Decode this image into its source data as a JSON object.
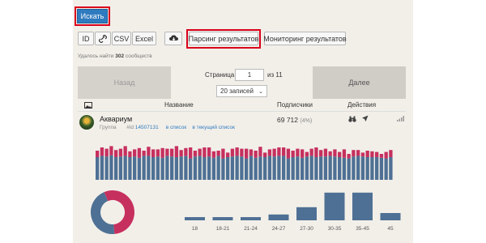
{
  "search_button": "Искать",
  "export_buttons": [
    "ID",
    "CSV",
    "Excel"
  ],
  "parse_button": "Парсинг результатов",
  "monitor_button": "Мониторинг результатов",
  "found_prefix": "Удалось найти",
  "found_count": "302",
  "found_suffix": "сообществ",
  "pager": {
    "back": "Назад",
    "page_label": "Страница",
    "page_value": "1",
    "of_label": "из 11",
    "per_page": "20 записей",
    "next": "Далее"
  },
  "table": {
    "col_name": "Название",
    "col_subs": "Подписчики",
    "col_actions": "Действия"
  },
  "row": {
    "name": "Аквариум",
    "type": "Группа",
    "id_label": "#id",
    "id_value": "14507131",
    "to_list": "в список",
    "to_current_list": "в текущий список",
    "subscribers": "69 712",
    "percent": "(4%)"
  },
  "colors": {
    "accent_blue": "#2f7bbf",
    "bar_blue": "#4e7094",
    "bar_red": "#c6305f",
    "highlight_red": "#d9001b"
  },
  "chart_data": [
    {
      "type": "bar",
      "stacked": true,
      "series": [
        {
          "values": [
            0.7,
            0.74,
            0.72,
            0.76,
            0.7,
            0.72,
            0.74,
            0.7,
            0.72,
            0.68,
            0.74,
            0.74,
            0.7,
            0.72,
            0.68,
            0.74,
            0.72,
            0.7,
            0.72,
            0.74,
            0.66,
            0.72,
            0.74,
            0.7,
            0.72,
            0.68,
            0.74,
            0.66,
            0.7,
            0.72,
            0.74,
            0.72,
            0.66,
            0.74,
            0.68,
            0.72,
            0.7,
            0.74,
            0.72,
            0.74,
            0.74,
            0.66,
            0.7,
            0.72,
            0.68,
            0.72,
            0.74,
            0.7,
            0.72,
            0.72,
            0.74,
            0.72,
            0.7,
            0.68,
            0.66,
            0.72,
            0.74,
            0.72,
            0.7,
            0.7,
            0.7,
            0.68,
            0.66,
            0.7
          ]
        },
        {
          "values": [
            0.2,
            0.26,
            0.24,
            0.28,
            0.22,
            0.24,
            0.3,
            0.18,
            0.22,
            0.3,
            0.16,
            0.28,
            0.24,
            0.22,
            0.3,
            0.22,
            0.24,
            0.34,
            0.2,
            0.24,
            0.34,
            0.18,
            0.22,
            0.3,
            0.28,
            0.2,
            0.16,
            0.3,
            0.14,
            0.24,
            0.26,
            0.24,
            0.3,
            0.2,
            0.22,
            0.3,
            0.14,
            0.2,
            0.24,
            0.26,
            0.26,
            0.3,
            0.2,
            0.24,
            0.26,
            0.14,
            0.22,
            0.3,
            0.2,
            0.24,
            0.14,
            0.22,
            0.16,
            0.26,
            0.14,
            0.2,
            0.18,
            0.12,
            0.2,
            0.18,
            0.16,
            0.12,
            0.2,
            0.22
          ]
        }
      ]
    },
    {
      "type": "pie",
      "donut": true,
      "values": [
        0.55,
        0.45
      ],
      "colors": [
        "#c6305f",
        "#4e7094"
      ]
    },
    {
      "type": "bar",
      "categories": [
        "18",
        "18-21",
        "21-24",
        "24-27",
        "27-30",
        "30-35",
        "35-45",
        "45"
      ],
      "values": [
        0.11,
        0.11,
        0.11,
        0.2,
        0.45,
        0.95,
        0.95,
        0.25
      ],
      "ylim": [
        0,
        1
      ]
    }
  ]
}
